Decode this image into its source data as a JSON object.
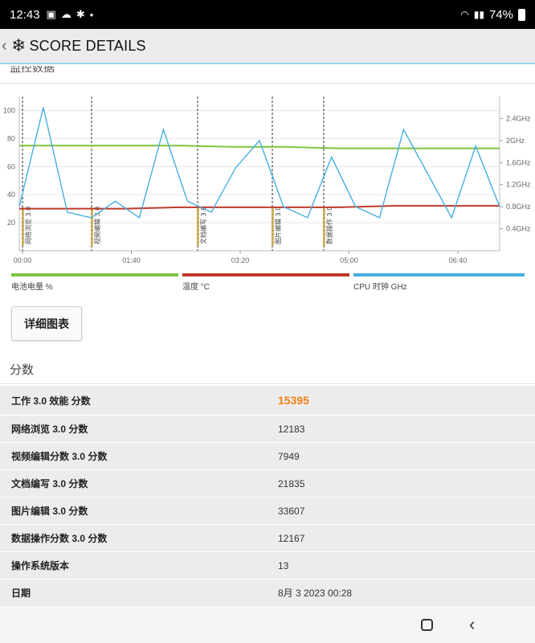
{
  "status": {
    "time": "12:43",
    "battery": "74%"
  },
  "appbar": {
    "title": "SCORE DETAILS"
  },
  "section": {
    "cut_title": "监控数据"
  },
  "chart_data": {
    "type": "line",
    "left_ticks": [
      "100",
      "80",
      "60",
      "40",
      "20"
    ],
    "left_ylim": [
      0,
      110
    ],
    "right_ticks": [
      "2.4GHz",
      "2GHz",
      "1.6GHz",
      "1.2GHz",
      "0.8GHz",
      "0.4GHz"
    ],
    "x_ticks": [
      "00:00",
      "01:40",
      "03:20",
      "05:00",
      "06:40"
    ],
    "event_labels": [
      "网络浏览 3.0",
      "视频编辑 3.0",
      "文档编写 3.0",
      "图片编辑 3.0",
      "数据操作 3.0"
    ],
    "event_times": [
      0.0,
      0.107,
      0.297,
      0.418,
      0.5
    ],
    "series": [
      {
        "name": "电池电量 %",
        "color": "#7cc442",
        "values": [
          75,
          75,
          75,
          75,
          74,
          74,
          73,
          73,
          73,
          73
        ]
      },
      {
        "name": "温度 °C",
        "color": "#c0392b",
        "values": [
          30,
          30,
          30,
          31,
          31,
          31,
          31,
          32,
          32,
          32
        ]
      },
      {
        "name": "CPU 时钟 GHz",
        "color": "#48aee0",
        "values": [
          0.8,
          2.6,
          0.7,
          0.6,
          0.9,
          0.6,
          2.2,
          0.9,
          0.7,
          1.5,
          2.0,
          0.8,
          0.6,
          1.7,
          0.8,
          0.6,
          2.2,
          1.4,
          0.6,
          1.9,
          0.8
        ]
      }
    ]
  },
  "legend": {
    "battery": "电池电量 %",
    "temp": "温度 °C",
    "cpu": "CPU 时钟 GHz",
    "battery_color": "#7cc442",
    "temp_color": "#c0392b",
    "cpu_color": "#48aee0"
  },
  "detail_button": "详细图表",
  "scores": {
    "title": "分数",
    "rows": [
      {
        "label": "工作 3.0 效能 分数",
        "value": "15395"
      },
      {
        "label": "网络浏览 3.0 分数",
        "value": "12183"
      },
      {
        "label": "视频编辑分数 3.0 分数",
        "value": "7949"
      },
      {
        "label": "文档编写 3.0 分数",
        "value": "21835"
      },
      {
        "label": "图片编辑 3.0 分数",
        "value": "33607"
      },
      {
        "label": "数据操作分数 3.0 分数",
        "value": "12167"
      },
      {
        "label": "操作系统版本",
        "value": "13"
      },
      {
        "label": "日期",
        "value": "8月 3 2023 00:28"
      }
    ]
  }
}
